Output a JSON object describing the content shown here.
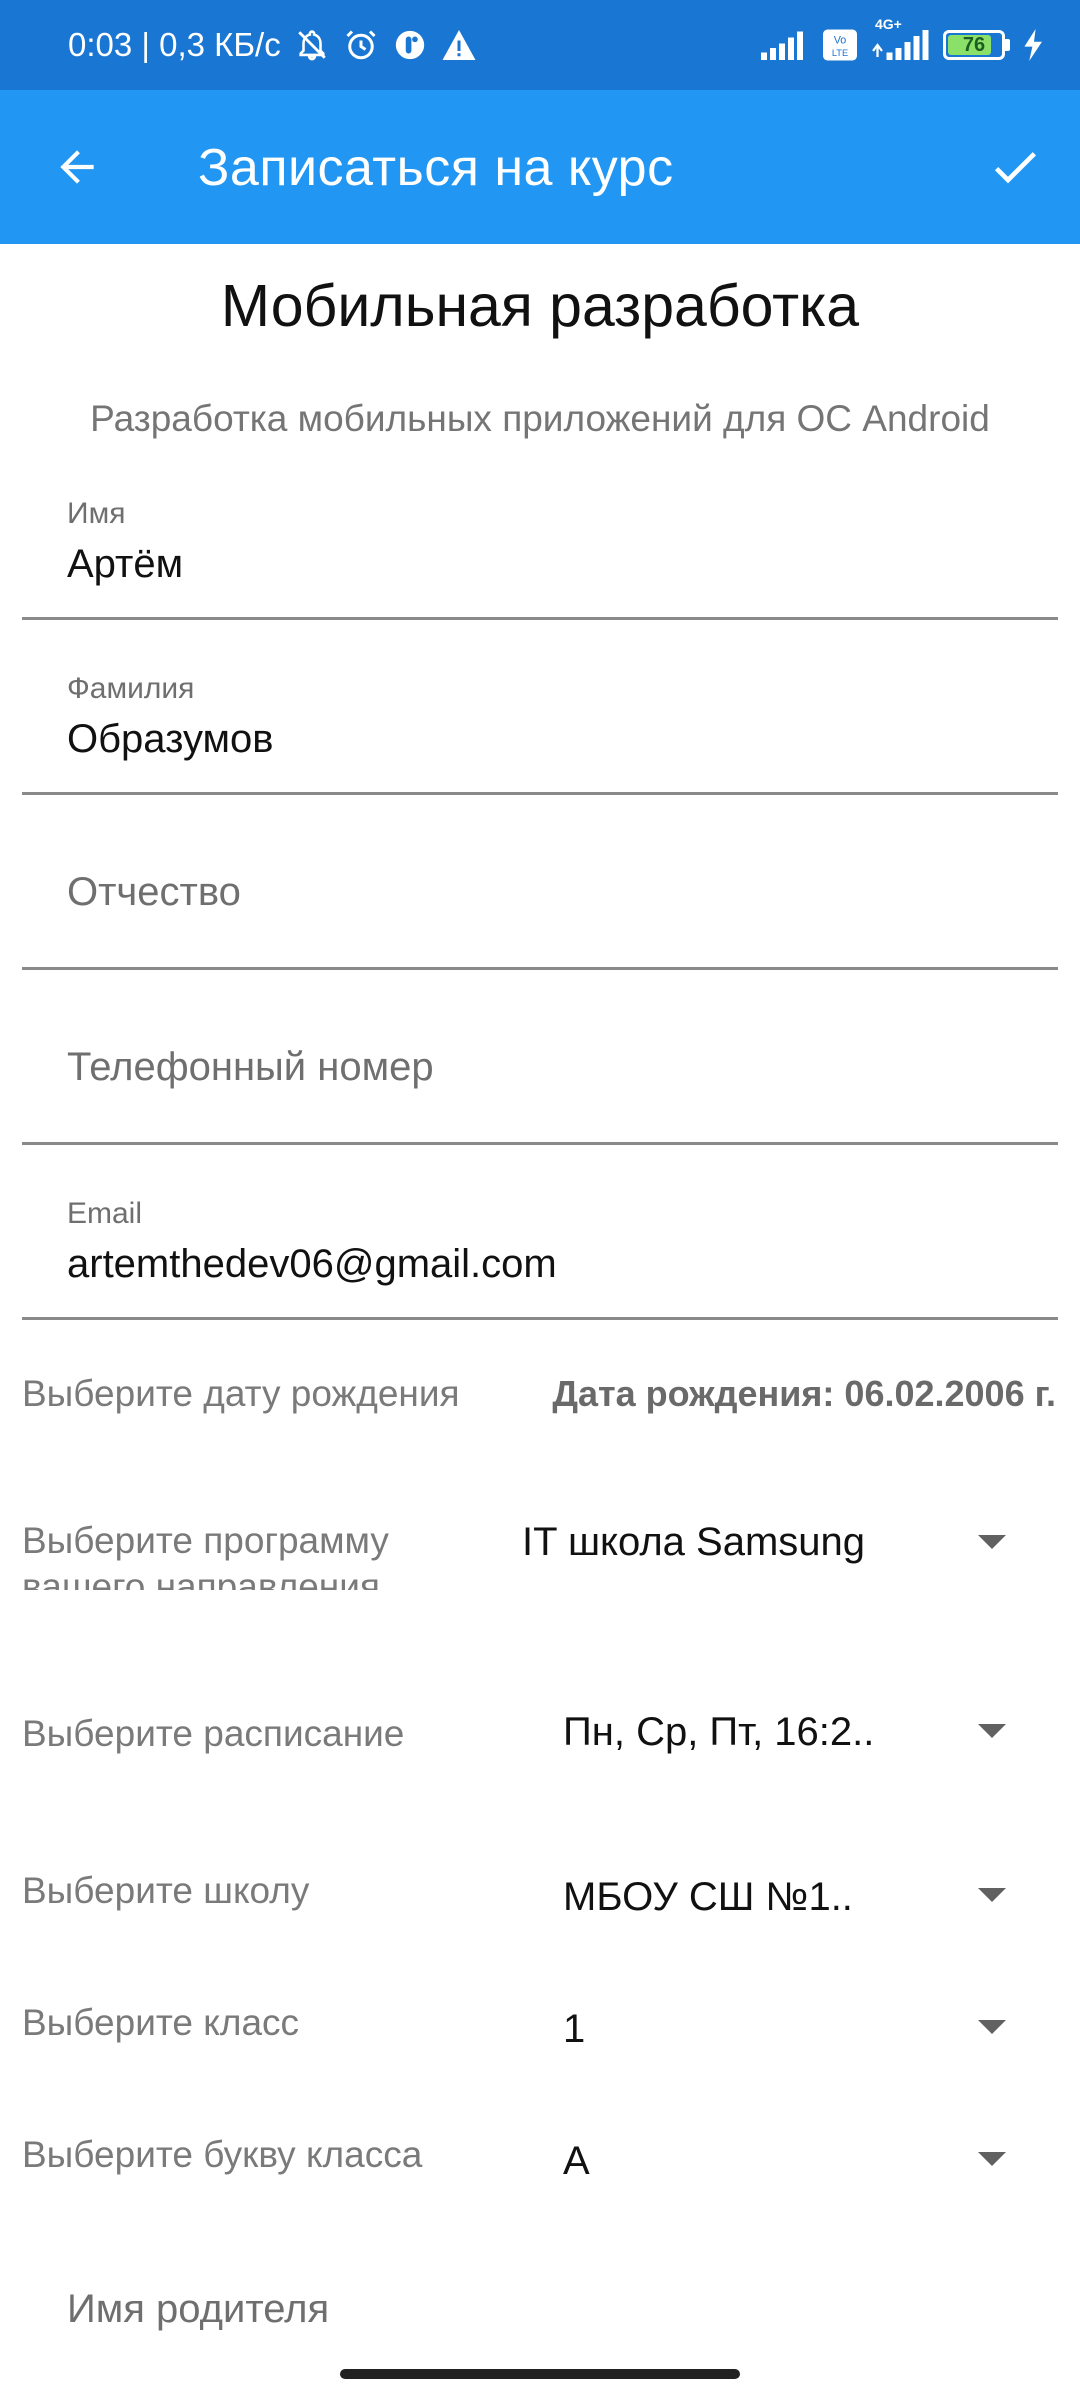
{
  "status_bar": {
    "time_speed": "0:03 | 0,3 КБ/с",
    "network_4g": "4G+",
    "volte": "Vo LTE",
    "battery": "76",
    "colors": {
      "bar": "#1976D2",
      "battery_fill": "#8BE06A"
    }
  },
  "app_bar": {
    "title": "Записаться на курс",
    "back_icon": "arrow-back-icon",
    "confirm_icon": "check-icon",
    "color": "#2196F3"
  },
  "course": {
    "title": "Мобильная разработка",
    "description": "Разработка мобильных приложений для ОС Android"
  },
  "fields": {
    "first_name": {
      "label": "Имя",
      "value": "Артём"
    },
    "last_name": {
      "label": "Фамилия",
      "value": "Образумов"
    },
    "patronymic": {
      "placeholder": "Отчество"
    },
    "phone": {
      "placeholder": "Телефонный номер"
    },
    "email": {
      "label": "Email",
      "value": "artemthedev06@gmail.com"
    },
    "parent_name": {
      "placeholder": "Имя родителя"
    }
  },
  "birth_date": {
    "label": "Выберите дату рождения",
    "value": "Дата рождения: 06.02.2006 г."
  },
  "selects": {
    "program": {
      "label": "Выберите программу вашего направления",
      "value": "IT школа Samsung"
    },
    "schedule": {
      "label": "Выберите расписание",
      "value": "Пн, Ср, Пт, 16:2.."
    },
    "school": {
      "label": "Выберите школу",
      "value": "МБОУ СШ №1.."
    },
    "grade": {
      "label": "Выберите класс",
      "value": "1"
    },
    "grade_letter": {
      "label": "Выберите букву класса",
      "value": "А"
    }
  }
}
